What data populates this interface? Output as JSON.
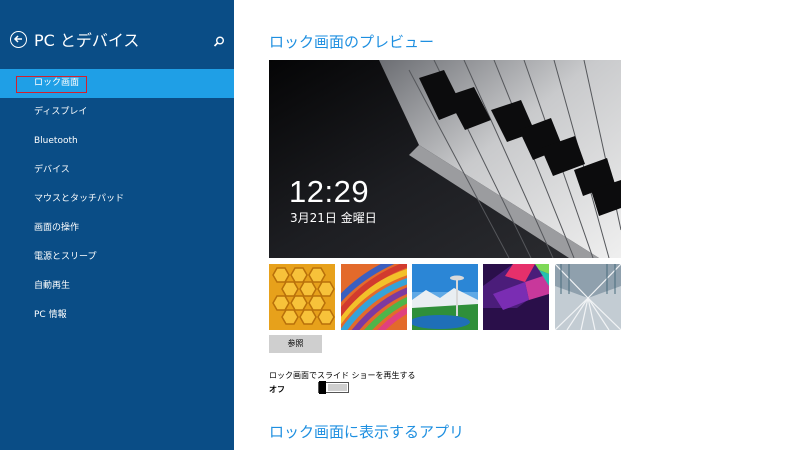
{
  "sidebar": {
    "title": "PC とデバイス",
    "items": [
      {
        "label": "ロック画面"
      },
      {
        "label": "ディスプレイ"
      },
      {
        "label": "Bluetooth"
      },
      {
        "label": "デバイス"
      },
      {
        "label": "マウスとタッチパッド"
      },
      {
        "label": "画面の操作"
      },
      {
        "label": "電源とスリープ"
      },
      {
        "label": "自動再生"
      },
      {
        "label": "PC 情報"
      }
    ]
  },
  "main": {
    "preview_heading": "ロック画面のプレビュー",
    "lock_time": "12:29",
    "lock_date": "3月21日 金曜日",
    "browse_label": "参照",
    "slideshow_label": "ロック画面でスライド ショーを再生する",
    "slideshow_state": "オフ",
    "apps_heading": "ロック画面に表示するアプリ"
  },
  "colors": {
    "sidebar_bg": "#0a4d86",
    "active_item_bg": "#1f9fe6",
    "accent_heading": "#1e8fe0",
    "focus_outline": "#d3202d",
    "button_bg": "#cfcfcf"
  },
  "icons": {
    "back": "back-arrow-icon",
    "search": "search-icon"
  }
}
